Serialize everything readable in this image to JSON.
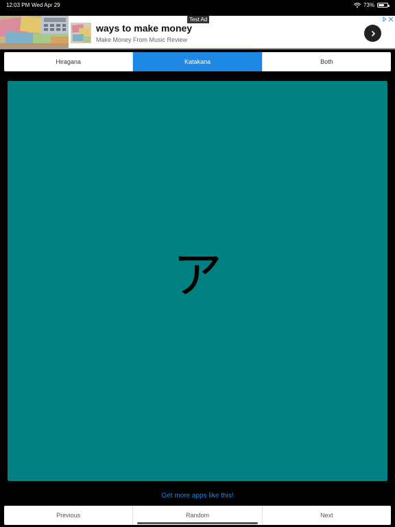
{
  "status_bar": {
    "time": "12:03 PM",
    "date": "Wed Apr 29",
    "battery": "73%",
    "battery_level": 0.73,
    "icons": [
      "wifi-icon",
      "battery-icon"
    ]
  },
  "ad": {
    "label": "Test Ad",
    "title": "ways to make money",
    "subtitle": "Make Money From Music Review",
    "icons": [
      "money-banner-image",
      "app-icon",
      "chevron-right-icon",
      "ad-choices-icon",
      "close-icon"
    ]
  },
  "tabs": [
    {
      "label": "Hiragana",
      "active": false
    },
    {
      "label": "Katakana",
      "active": true
    },
    {
      "label": "Both",
      "active": false
    }
  ],
  "card": {
    "character": "ア",
    "background": "#008080"
  },
  "links": {
    "more_apps": "Get more apps like this!"
  },
  "nav": {
    "previous": "Previous",
    "random": "Random",
    "next": "Next"
  },
  "colors": {
    "accent": "#1e88e5",
    "card": "#008080",
    "background": "#000000"
  }
}
